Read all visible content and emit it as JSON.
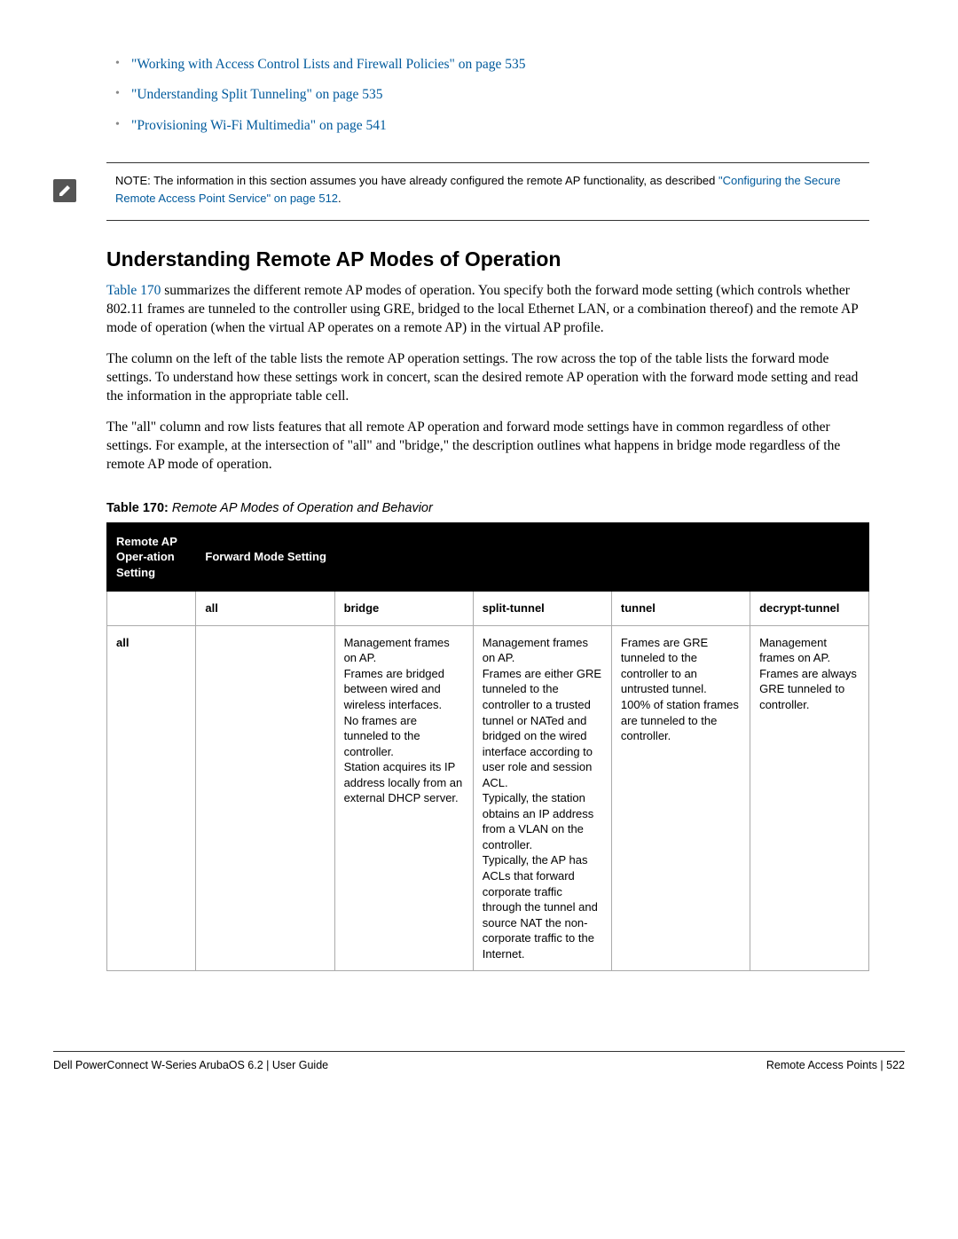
{
  "links": [
    "\"Working with Access Control Lists and Firewall Policies\" on page 535",
    "\"Understanding Split Tunneling\" on page 535",
    "\"Provisioning Wi-Fi Multimedia\" on page 541"
  ],
  "note": {
    "prefix": "NOTE: The information in this section assumes you have already configured the remote AP functionality, as described ",
    "link": "\"Configuring the Secure Remote Access Point Service\" on page 512",
    "suffix": "."
  },
  "heading": "Understanding Remote AP Modes of Operation",
  "para1_linkpre": "",
  "para1_link": "Table 170",
  "para1_rest": " summarizes the different remote AP modes of operation. You specify both the forward mode setting (which controls whether 802.11 frames are tunneled to the controller using GRE, bridged to the local Ethernet LAN, or a combination thereof) and the remote AP mode of operation (when the virtual AP operates on a remote AP) in the virtual AP profile.",
  "para2": "The column on the left of the table lists the remote AP operation settings. The row across the top of the table lists the forward mode settings. To understand how these settings work in concert, scan the desired remote AP operation with the forward mode setting and read the information in the appropriate table cell.",
  "para3": "The \"all\" column and row lists features that all remote AP operation and forward mode settings have in common regardless of other settings. For example, at the intersection of \"all\" and \"bridge,\" the description outlines what happens in bridge mode regardless of the remote AP mode of operation.",
  "table_caption_bold": "Table 170:",
  "table_caption_italic": " Remote AP Modes of Operation and Behavior",
  "table": {
    "head_col1": "Remote AP Oper-ation Setting",
    "head_col2": "Forward Mode Setting",
    "sub": {
      "c1": "",
      "c2": "all",
      "c3": "bridge",
      "c4": "split-tunnel",
      "c5": "tunnel",
      "c6": "decrypt-tunnel"
    },
    "row_all": {
      "label": "all",
      "all": "",
      "bridge": "Management frames on AP.\nFrames are bridged between wired and wireless interfaces.\nNo frames are tunneled to the controller.\nStation acquires its IP address locally from an external DHCP server.",
      "split": "Management frames on AP.\nFrames are either GRE tunneled to the controller to a trusted tunnel or NATed and bridged on the wired interface according to user role and session ACL.\nTypically, the station obtains an IP address from a VLAN on the controller.\nTypically, the AP has ACLs that forward corporate traffic through the tunnel and source NAT the non-corporate traffic to the Internet.",
      "tunnel": "Frames are GRE tunneled to the controller to an untrusted tunnel.\n100% of station frames are tunneled to the controller.",
      "decrypt": "Management frames on AP.\nFrames are always GRE tunneled to controller."
    }
  },
  "footer": {
    "left": "Dell PowerConnect W-Series ArubaOS 6.2 | User Guide",
    "right": "Remote Access Points | 522"
  }
}
